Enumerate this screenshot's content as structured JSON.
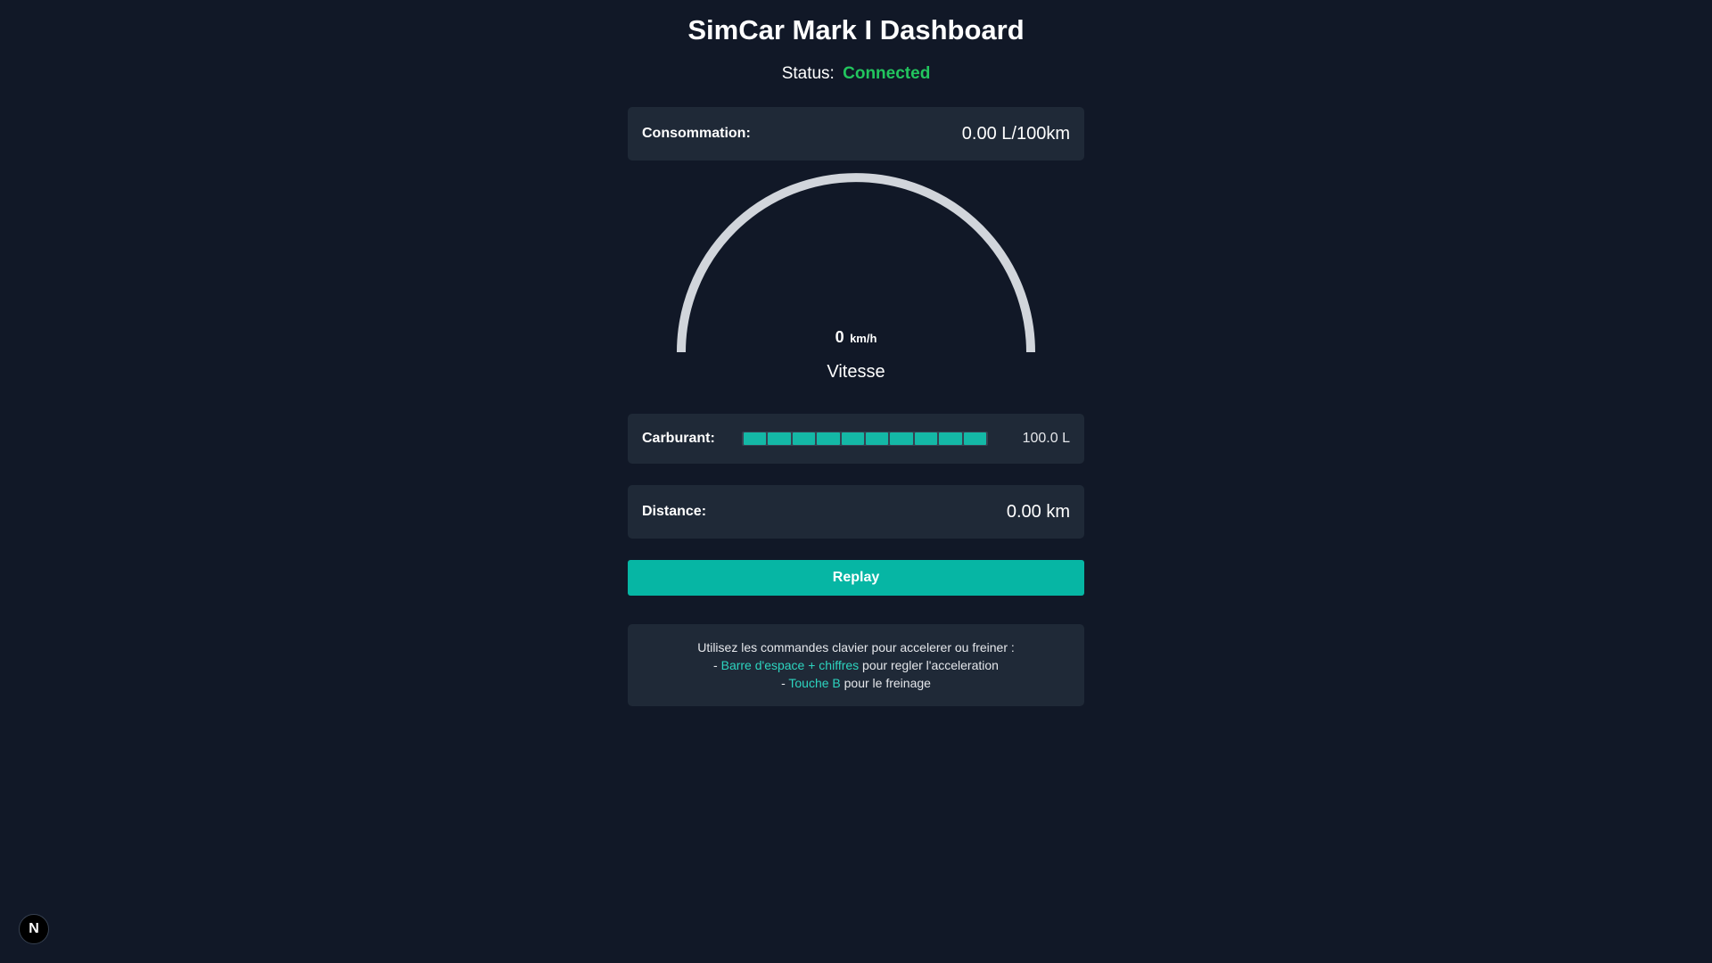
{
  "title": "SimCar Mark I Dashboard",
  "status": {
    "label": "Status:",
    "value": "Connected",
    "color": "#22c55e"
  },
  "consumption": {
    "label": "Consommation:",
    "value": "0.00 L/100km"
  },
  "speedometer": {
    "speed": "0",
    "unit": "km/h",
    "caption": "Vitesse",
    "speed_value": 0
  },
  "fuel": {
    "label": "Carburant:",
    "value": "100.0 L",
    "level_fraction": 1.0,
    "segments": 10,
    "color": "#14b8a6"
  },
  "distance": {
    "label": "Distance:",
    "value": "0.00 km"
  },
  "replay_button": {
    "label": "Replay",
    "color": "#06b6a4"
  },
  "help": {
    "intro": "Utilisez les commandes clavier pour accelerer ou freiner :",
    "line1_prefix": "- ",
    "line1_key": "Barre d'espace + chiffres",
    "line1_suffix": " pour regler l'acceleration",
    "line2_prefix": "- ",
    "line2_key": "Touche B",
    "line2_suffix": " pour le freinage",
    "key_color": "#2dd4bf"
  },
  "dev_badge": {
    "letter": "N",
    "icon": "nextjs-icon"
  }
}
